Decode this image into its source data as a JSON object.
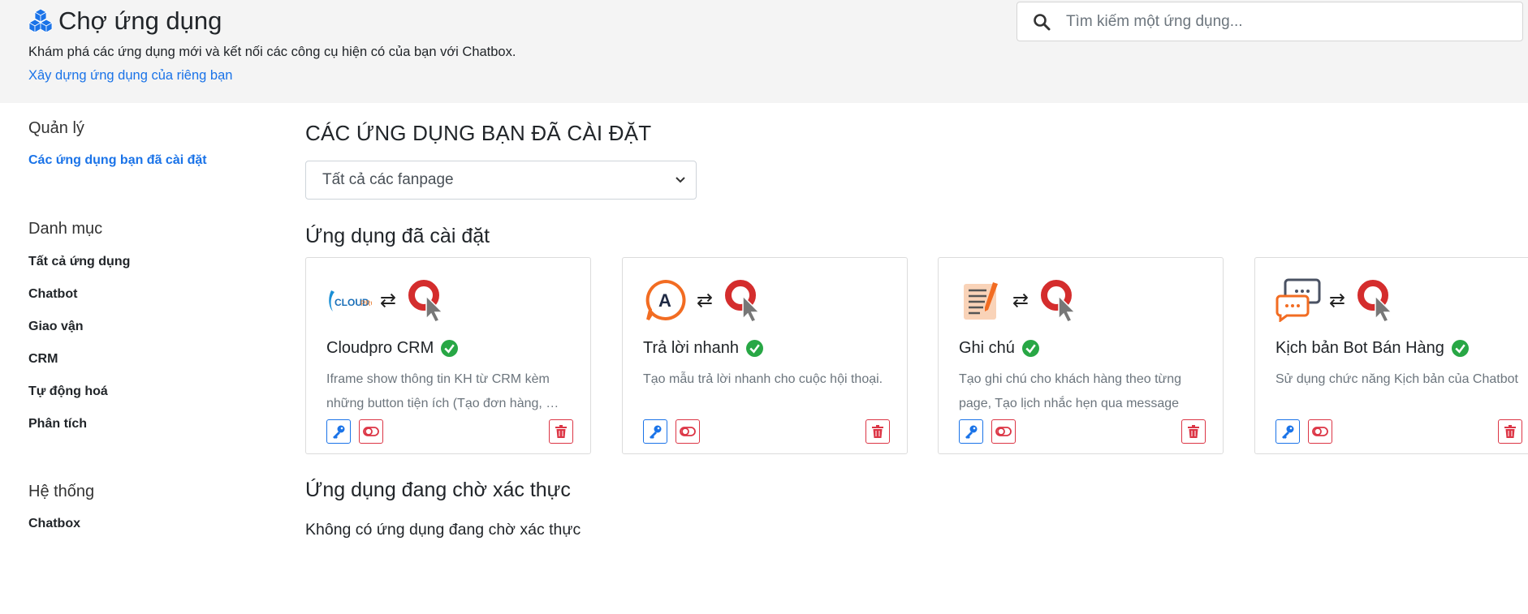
{
  "header": {
    "title": "Chợ ứng dụng",
    "subtitle": "Khám phá các ứng dụng mới và kết nối các công cụ hiện có của bạn với Chatbox.",
    "build_link": "Xây dựng ứng dụng của riêng bạn",
    "search_placeholder": "Tìm kiếm một ứng dụng..."
  },
  "sidebar": {
    "manage_heading": "Quản lý",
    "manage_items": [
      {
        "label": "Các ứng dụng bạn đã cài đặt",
        "active": true
      }
    ],
    "category_heading": "Danh mục",
    "category_items": [
      {
        "label": "Tất cả ứng dụng"
      },
      {
        "label": "Chatbot"
      },
      {
        "label": "Giao vận"
      },
      {
        "label": "CRM"
      },
      {
        "label": "Tự động hoá"
      },
      {
        "label": "Phân tích"
      }
    ],
    "system_heading": "Hệ thống",
    "system_items": [
      {
        "label": "Chatbox"
      }
    ]
  },
  "main": {
    "section_title": "CÁC ỨNG DỤNG BẠN ĐÃ CÀI ĐẶT",
    "fanpage_select": "Tất cả các fanpage",
    "installed_title": "Ứng dụng đã cài đặt",
    "apps": [
      {
        "name": "Cloudpro CRM",
        "desc": "Iframe show thông tin KH từ CRM kèm những button tiện ích (Tạo đơn hàng, …",
        "icon": "cloudpro-logo"
      },
      {
        "name": "Trả lời nhanh",
        "desc": "Tạo mẫu trả lời nhanh cho cuộc hội thoại.",
        "icon": "quick-reply-logo"
      },
      {
        "name": "Ghi chú",
        "desc": "Tạo ghi chú cho khách hàng theo từng page, Tạo lịch nhắc hẹn qua message",
        "icon": "note-logo"
      },
      {
        "name": "Kịch bản Bot Bán Hàng",
        "desc": "Sử dụng chức năng Kịch bản của Chatbot",
        "icon": "chat-bubbles-logo"
      }
    ],
    "pending_title": "Ứng dụng đang chờ xác thực",
    "pending_empty": "Không có ứng dụng đang chờ xác thực"
  },
  "colors": {
    "accent": "#1a73e8",
    "danger": "#dc3545",
    "success": "#28a745",
    "header_bg": "#f4f4f4"
  }
}
